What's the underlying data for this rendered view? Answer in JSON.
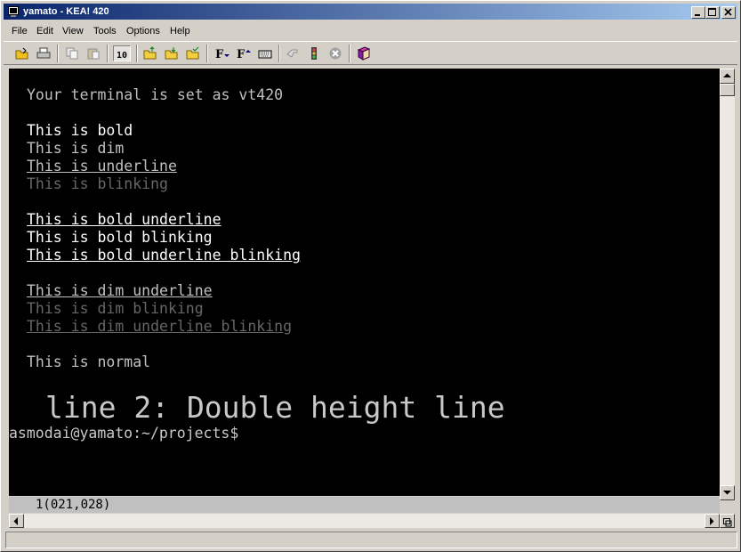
{
  "window": {
    "title": "yamato - KEA! 420",
    "app_icon": "terminal-icon"
  },
  "menu": {
    "items": [
      "File",
      "Edit",
      "View",
      "Tools",
      "Options",
      "Help"
    ]
  },
  "toolbar": {
    "icons": [
      "open-folder-icon",
      "print-icon",
      "copy-icon",
      "paste-icon",
      "binary-icon",
      "folder-up-icon",
      "folder-open-icon",
      "folder-check-icon",
      "font-down-icon",
      "font-up-icon",
      "keyboard-icon",
      "hand-icon",
      "traffic-light-icon",
      "stop-icon",
      "book-icon"
    ]
  },
  "terminal": {
    "lines": [
      "Your terminal is set as vt420",
      "This is bold",
      "This is dim",
      "This is underline",
      "This is blinking",
      "This is bold underline",
      "This is bold blinking",
      "This is bold underline blinking",
      "This is dim underline",
      "This is dim blinking",
      "This is dim underline blinking",
      "This is normal"
    ],
    "double_height": "line 2: Double height line",
    "prompt": "asmodai@yamato:~/projects$"
  },
  "status": {
    "position": "1(021,028)"
  },
  "colors": {
    "title_gradient_start": "#0a246a",
    "title_gradient_end": "#a6caf0",
    "terminal_bg": "#000000",
    "terminal_text": "#c8c8c8"
  }
}
